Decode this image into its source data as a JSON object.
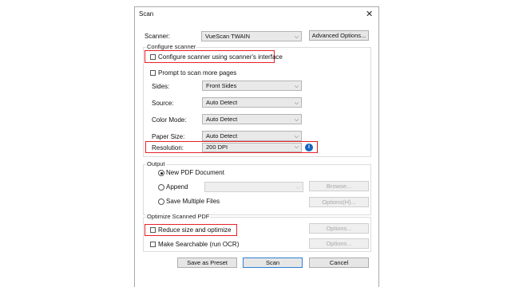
{
  "dialog": {
    "title": "Scan",
    "close_icon": "close-icon"
  },
  "scanner": {
    "label": "Scanner:",
    "value": "VueScan TWAIN",
    "advanced_label": "Advanced Options..."
  },
  "configure": {
    "group_label": "Configure scanner",
    "use_interface_label": "Configure scanner using scanner's interface",
    "prompt_more_label": "Prompt to scan more pages",
    "sides": {
      "label": "Sides:",
      "value": "Front Sides"
    },
    "source": {
      "label": "Source:",
      "value": "Auto Detect"
    },
    "color_mode": {
      "label": "Color Mode:",
      "value": "Auto Detect"
    },
    "paper_size": {
      "label": "Paper Size:",
      "value": "Auto Detect"
    },
    "resolution": {
      "label": "Resolution:",
      "value": "200  DPI"
    },
    "info_icon": "info-icon"
  },
  "output": {
    "group_label": "Output",
    "new_pdf_label": "New PDF Document",
    "append_label": "Append",
    "browse_label": "Browse...",
    "save_multiple_label": "Save Multiple Files",
    "options_h_label": "Options(H)..."
  },
  "optimize": {
    "group_label": "Optimize Scanned PDF",
    "reduce_label": "Reduce size and optimize",
    "reduce_options_label": "Options...",
    "searchable_label": "Make Searchable (run OCR)",
    "searchable_options_label": "Options..."
  },
  "footer": {
    "preset_label": "Save as Preset",
    "scan_label": "Scan",
    "cancel_label": "Cancel"
  },
  "colors": {
    "highlight": "#e8202a",
    "primary_border": "#2f7fd5",
    "info": "#1565c0"
  }
}
